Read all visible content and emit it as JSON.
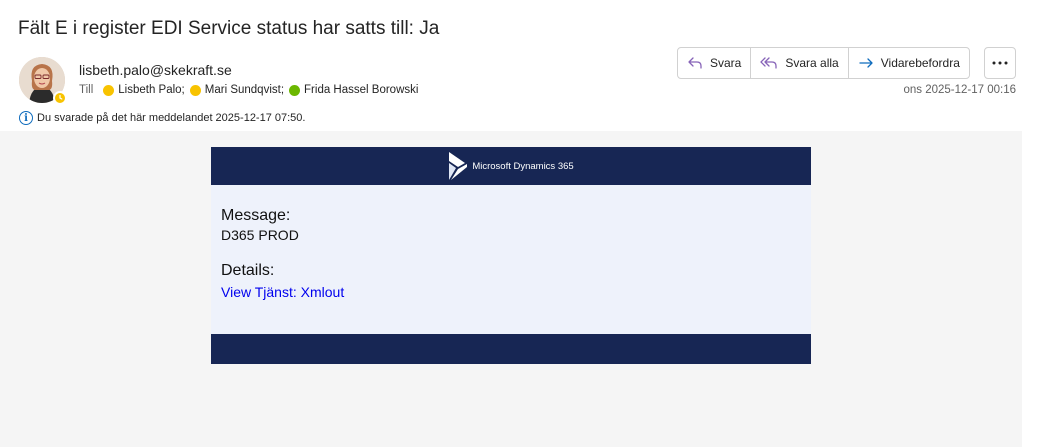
{
  "email": {
    "subject": "Fält E i register EDI Service status har satts till: Ja",
    "sender": "lisbeth.palo@skekraft.se",
    "to_label": "Till",
    "recipients": [
      {
        "name": "Lisbeth Palo;",
        "status": "away"
      },
      {
        "name": "Mari Sundqvist;",
        "status": "away"
      },
      {
        "name": "Frida Hassel Borowski",
        "status": "available"
      }
    ],
    "info": "Du svarade på det här meddelandet 2025-12-17 07:50.",
    "timestamp": "ons 2025-12-17 00:16"
  },
  "toolbar": {
    "reply_label": "Svara",
    "reply_all_label": "Svara alla",
    "forward_label": "Vidarebefordra"
  },
  "message": {
    "brand": "Microsoft Dynamics 365",
    "message_label": "Message:",
    "message_value": "D365 PROD",
    "details_label": "Details:",
    "details_link": "View Tjänst: Xmlout"
  },
  "colors": {
    "header_bg": "#172654",
    "body_bg": "#eef2fb",
    "link": "#0000ee",
    "presence_away": "#f8c300",
    "presence_available": "#6bb700",
    "reply_icon": "#8764b8",
    "forward_icon": "#0f6cbd"
  },
  "icons": {
    "avatar": "avatar",
    "presence": "clock-icon",
    "info": "info-icon",
    "reply": "reply-arrow-icon",
    "reply_all": "reply-all-arrow-icon",
    "forward": "forward-arrow-icon",
    "more": "more-horizontal-icon",
    "brand": "dynamics-365-logo-icon"
  }
}
